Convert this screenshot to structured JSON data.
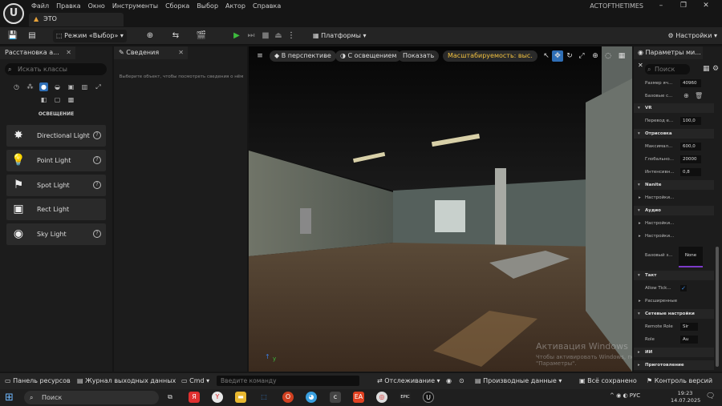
{
  "menu": [
    "Файл",
    "Правка",
    "Окно",
    "Инструменты",
    "Сборка",
    "Выбор",
    "Актор",
    "Справка"
  ],
  "doc_tab": {
    "label": "ЭТО"
  },
  "project_name": "ACTOFTHETIMES",
  "window_controls": {
    "minimize": "–",
    "restore": "❐",
    "close": "✕"
  },
  "toolbar": {
    "mode": "Режим «Выбор»",
    "platforms": "Платформы",
    "settings": "Настройки"
  },
  "place_panel": {
    "tab": "Расстановка а...",
    "search_placeholder": "Искать классы",
    "category_title": "ОСВЕЩЕНИЕ",
    "items": [
      {
        "label": "Directional Light",
        "icon": "directional-light-icon"
      },
      {
        "label": "Point Light",
        "icon": "point-light-icon"
      },
      {
        "label": "Spot Light",
        "icon": "spot-light-icon"
      },
      {
        "label": "Rect Light",
        "icon": "rect-light-icon"
      },
      {
        "label": "Sky Light",
        "icon": "sky-light-icon"
      }
    ]
  },
  "details_panel": {
    "tab": "Сведения",
    "hint": "Выберите объект, чтобы посмотреть сведения о нём"
  },
  "viewport": {
    "perspective": "В перспективе",
    "lighting": "С освещением",
    "show": "Показать",
    "scalability": "Масштабируемость: выс.",
    "watermark_title": "Активация Windows",
    "watermark_text": "Чтобы активировать Windows, перейдите в раздел \"Параметры\"."
  },
  "world_settings": {
    "tab": "Параметры ми...",
    "search_placeholder": "Поиск",
    "rows": {
      "cell_size": {
        "label": "Размер яч...",
        "value": "40960"
      },
      "base_s": {
        "label": "Базовые с..."
      },
      "vr_section": "VR",
      "world_to_meters": {
        "label": "Перевод е...",
        "value": "100,0"
      },
      "render_section": "Отрисовка",
      "max": {
        "label": "Максимал...",
        "value": "600,0"
      },
      "global": {
        "label": "Глобально...",
        "value": "20000"
      },
      "intensity": {
        "label": "Интенсивн...",
        "value": "0,8"
      },
      "nanite_section": "Nanite",
      "nanite_settings": "Настройки...",
      "audio_section": "Аудио",
      "audio_settings1": "Настройки...",
      "audio_settings2": "Настройки...",
      "base_sound": {
        "label": "Базовый з...",
        "value": "None"
      },
      "tick_section": "Такт",
      "allow_tick": {
        "label": "Allow Tick...",
        "checked": true
      },
      "advanced": "Расширенные",
      "network_section": "Сетевые настройки",
      "remote_role": {
        "label": "Remote Role",
        "value": "Sir"
      },
      "role": {
        "label": "Role",
        "value": "Au"
      },
      "ai_section": "ИИ",
      "cooking_section": "Приготовление"
    }
  },
  "bottom_bar": {
    "content_browser": "Панель ресурсов",
    "output_log": "Журнал выходных данных",
    "cmd": "Cmd",
    "cmd_placeholder": "Введите  команду",
    "trace": "Отслеживание",
    "derived_data": "Производные данные",
    "saved": "Всё сохранено",
    "version_control": "Контроль версий"
  },
  "taskbar": {
    "search_placeholder": "Поиск",
    "lang": "РУС",
    "time": "19:23",
    "date": "14.07.2025"
  }
}
